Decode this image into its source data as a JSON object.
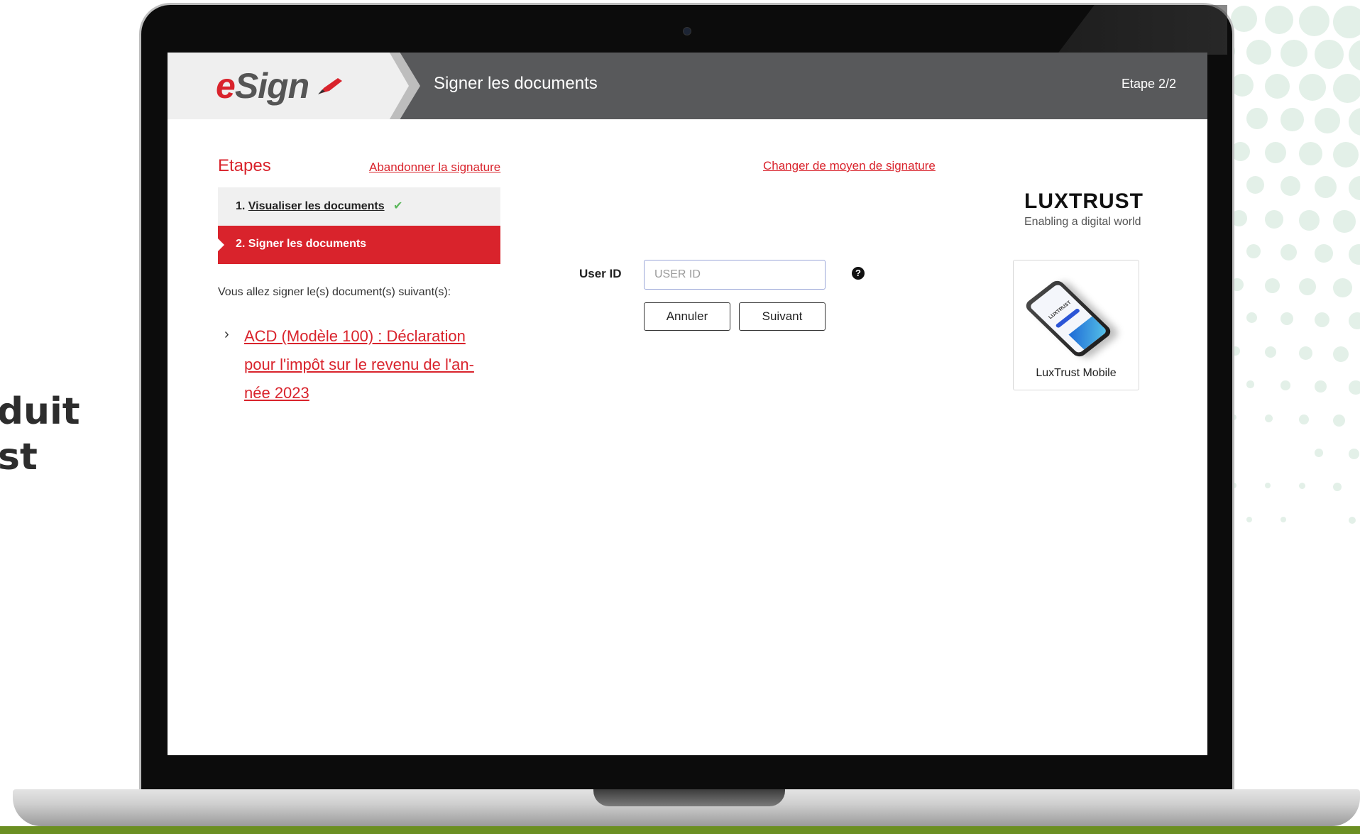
{
  "background": {
    "text_lines": [
      "oduit",
      "ust"
    ]
  },
  "header": {
    "logo": "eSign",
    "title": "Signer les documents",
    "step_indicator": "Etape 2/2"
  },
  "steps_panel": {
    "title": "Etapes",
    "abandon_link": "Abandonner la signature",
    "steps": [
      {
        "number": "1.",
        "label": "Visualiser les documents",
        "status": "done"
      },
      {
        "number": "2.",
        "label": "Signer les documents",
        "status": "active"
      }
    ],
    "intro_text": "Vous allez signer le(s) document(s) suivant(s):",
    "documents": [
      "ACD (Modèle 100) : Déclaration pour l'impôt sur le revenu de l'an-née 2023"
    ]
  },
  "signature_form": {
    "change_method_link": "Changer de moyen de signature",
    "user_id_label": "User ID",
    "user_id_value": "",
    "user_id_placeholder": "USER ID",
    "help_icon": "?",
    "cancel_label": "Annuler",
    "next_label": "Suivant"
  },
  "luxtrust": {
    "brand": "LUXTRUST",
    "tagline": "Enabling a digital world",
    "method_label": "LuxTrust Mobile",
    "phone_text": "LUXTRUST"
  },
  "colors": {
    "accent": "#d9232c",
    "header_bg": "#58595b",
    "check": "#5cb85c",
    "green_strip": "#6b8f22"
  }
}
